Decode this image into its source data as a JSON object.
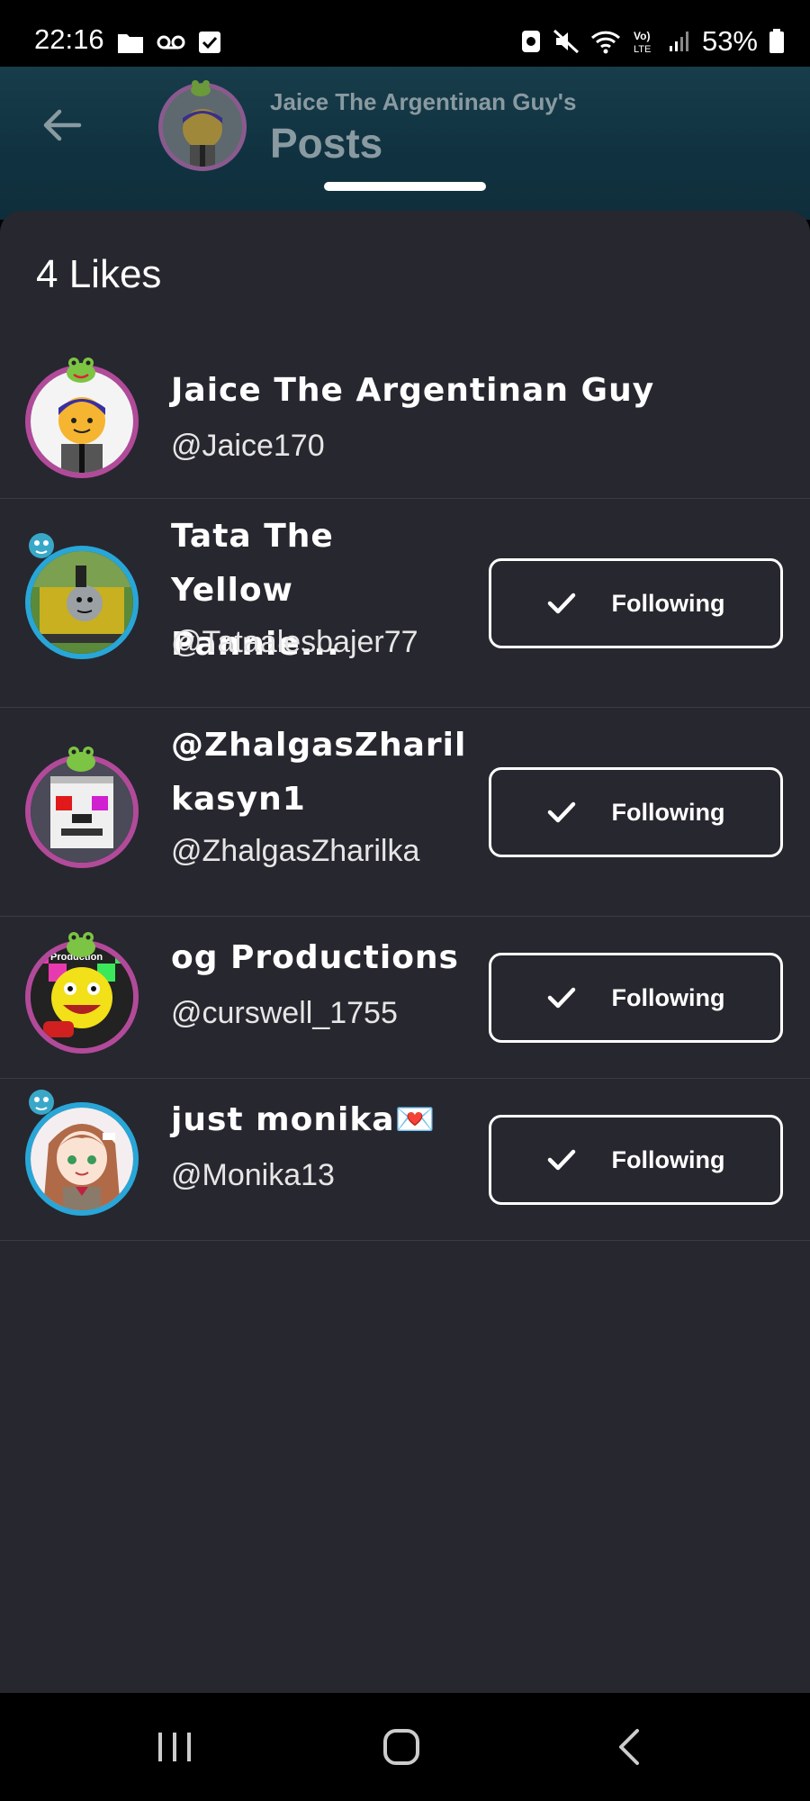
{
  "status_bar": {
    "time": "22:16",
    "battery": "53%",
    "icons": [
      "folder-icon",
      "voicemail-icon",
      "check-box-icon",
      "nfc-icon",
      "mute-icon",
      "wifi-icon",
      "volte-icon",
      "signal-icon",
      "battery-icon"
    ]
  },
  "header": {
    "subtitle": "Jaice The Argentinan Guy's",
    "title": "Posts"
  },
  "likes": {
    "count_label": "4 Likes"
  },
  "users": [
    {
      "name": "Jaice The Argentinan Guy",
      "handle": "@Jaice170",
      "following": false
    },
    {
      "name_line1": "Tata The",
      "name_line2": "Yellow Pannie...",
      "handle": "@Tataalesbajer77",
      "following_label": "Following"
    },
    {
      "name_line1": "@ZhalgasZharil",
      "name_line2": "kasyn1",
      "handle": "@ZhalgasZharilka",
      "following_label": "Following"
    },
    {
      "name": "og Productions",
      "handle": "@curswell_1755",
      "following_label": "Following"
    },
    {
      "name": "just monika💌",
      "handle": "@Monika13",
      "following_label": "Following"
    }
  ],
  "colors": {
    "sheet_bg": "#27272f",
    "header_bg": "#103240",
    "avatar_ring_pink": "#b24a9a",
    "avatar_ring_blue": "#28a6d8"
  }
}
